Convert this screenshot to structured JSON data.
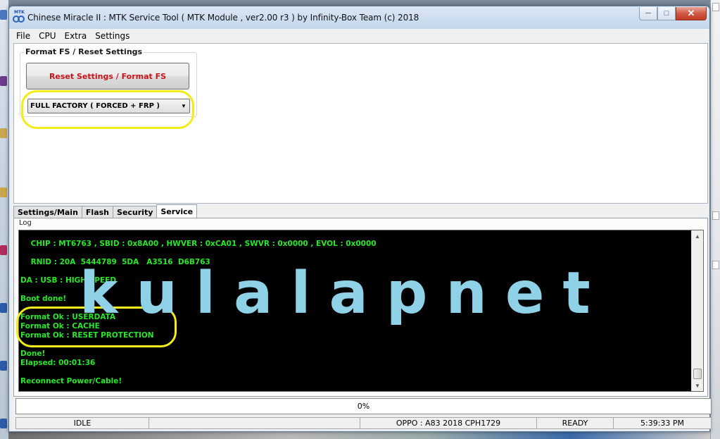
{
  "window": {
    "title": "Chinese Miracle II : MTK Service Tool ( MTK Module , ver2.00 r3  ) by Infinity-Box Team (c) 2018",
    "icon_label": "MTK",
    "minimize_glyph": "─",
    "maximize_glyph": "□",
    "close_glyph": "✕"
  },
  "menu": [
    "File",
    "CPU",
    "Extra",
    "Settings"
  ],
  "format_panel": {
    "group_title": "Format FS / Reset Settings",
    "reset_button": "Reset Settings / Format FS",
    "mode_value": "FULL FACTORY ( FORCED + FRP )",
    "dropdown_glyph": "▼"
  },
  "tabs": [
    "Settings/Main",
    "Flash",
    "Security",
    "Service"
  ],
  "active_tab": "Service",
  "log": {
    "label": "Log",
    "lines": [
      "    CHIP : MT6763 , SBID : 0x8A00 , HWVER : 0xCA01 , SWVR : 0x0000 , EVOL : 0x0000",
      "",
      "    RNID : 20A  5444789  5DA   A3516  D6B763",
      "",
      "DA : USB : HIGH SPEED",
      "",
      "Boot done!",
      "",
      "Format Ok : USERDATA",
      "Format Ok : CACHE",
      "Format Ok : RESET PROTECTION",
      "",
      "Done!",
      "Elapsed: 00:01:36",
      "",
      "Reconnect Power/Cable!"
    ],
    "text_color": "#28e628",
    "scroll_up_glyph": "▲",
    "scroll_down_glyph": "▼"
  },
  "watermark": "kulalapnet",
  "progress": {
    "label": "0%",
    "value": 0
  },
  "status": {
    "state": "IDLE",
    "device": "OPPO : A83 2018 CPH1729",
    "ready": "READY",
    "time": "5:39:33 PM"
  },
  "colors": {
    "highlight": "#f2ec18",
    "reset_text": "#c8141a",
    "watermark": "#8fd1e6"
  }
}
